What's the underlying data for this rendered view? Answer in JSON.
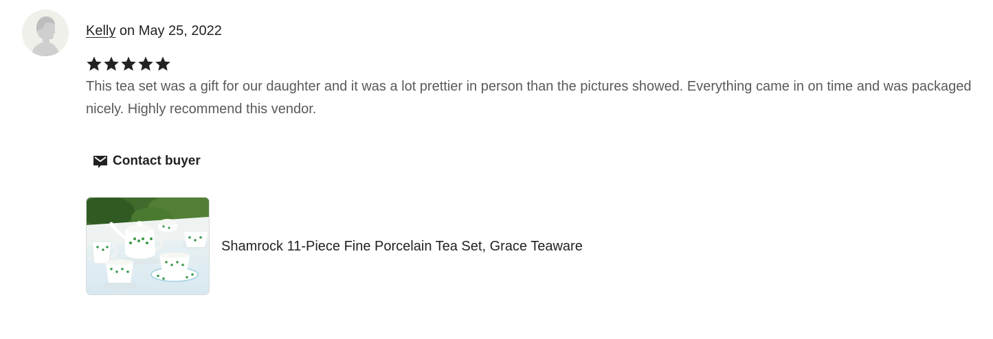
{
  "review": {
    "reviewer_name": "Kelly",
    "date_text": " on May 25, 2022",
    "rating": 5,
    "rating_max": 5,
    "text": "This tea set was a gift for our daughter and it was a lot prettier in person than the pictures showed. Everything came in on time and was packaged nicely. Highly recommend this vendor."
  },
  "actions": {
    "contact_label": "Contact buyer",
    "contact_icon": "envelope-icon"
  },
  "listing": {
    "title": "Shamrock 11-Piece Fine Porcelain Tea Set, Grace Teaware",
    "thumbnail_icon": "tea-set-thumbnail"
  },
  "colors": {
    "text": "#222222",
    "muted_text": "#595959",
    "star": "#222222",
    "avatar_bg": "#f0f0ea"
  }
}
